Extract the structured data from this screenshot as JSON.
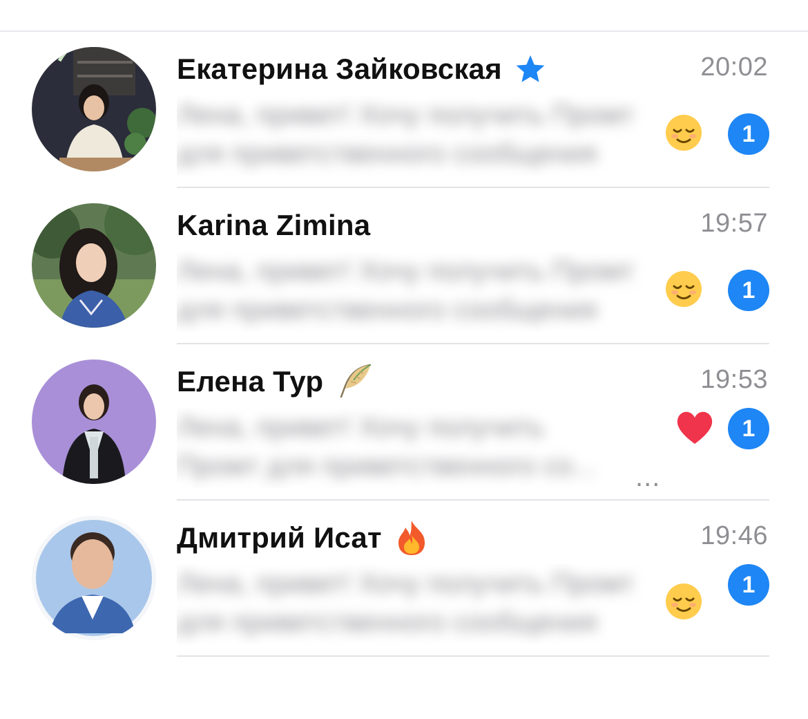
{
  "chats": [
    {
      "name": "Екатерина Зайковская",
      "status_icon": "star-icon",
      "time": "20:02",
      "preview_line1": "Лена, привет! Хочу получить Промт",
      "preview_line2": "для приветственного сообщения",
      "preview_emoji": "relieved-face-icon",
      "reaction": "",
      "unread": "1"
    },
    {
      "name": "Karina Zimina",
      "status_icon": "",
      "time": "19:57",
      "preview_line1": "Лена, привет! Хочу получить Промт",
      "preview_line2": "для приветственного сообщения",
      "preview_emoji": "relieved-face-icon",
      "reaction": "",
      "unread": "1"
    },
    {
      "name": "Елена Тур",
      "status_icon": "feather-icon",
      "time": "19:53",
      "preview_line1": "Лена, привет! Хочу получить",
      "preview_line2": "Промт для приветственного со...",
      "preview_emoji": "",
      "reaction": "heart-icon",
      "unread": "1"
    },
    {
      "name": "Дмитрий Исат",
      "status_icon": "fire-icon",
      "time": "19:46",
      "preview_line1": "Лена, привет! Хочу получить Промт",
      "preview_line2": "для приветственного сообщения",
      "preview_emoji": "relieved-face-icon",
      "reaction": "",
      "unread": "1"
    }
  ],
  "colors": {
    "badge": "#1e86f5",
    "time": "#8e8e93",
    "divider": "#e3e3e8",
    "star": "#1e86f5",
    "heart": "#f0344b",
    "avatar_purple": "#a98fd8"
  }
}
